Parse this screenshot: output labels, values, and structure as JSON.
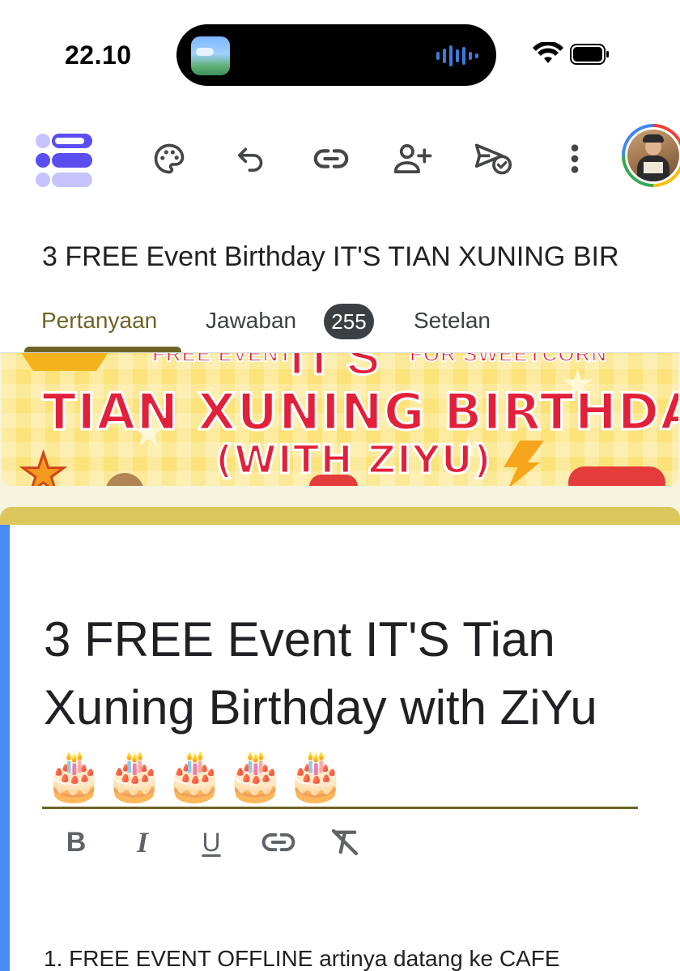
{
  "status_bar": {
    "time": "22.10"
  },
  "toolbar": {
    "icons": [
      "forms-logo",
      "palette-icon",
      "undo-icon",
      "link-icon",
      "add-collaborator-icon",
      "send-icon",
      "more-vert-icon",
      "avatar"
    ]
  },
  "form": {
    "doc_title": "3 FREE Event Birthday IT'S TIAN XUNING BIR"
  },
  "tabs": {
    "questions": "Pertanyaan",
    "responses": "Jawaban",
    "responses_count": "255",
    "settings": "Setelan",
    "active": "Pertanyaan"
  },
  "banner": {
    "top_left": "FREE EVENT",
    "top_its": "IT'S",
    "top_right": "FOR SWEETCORN",
    "main": "TIAN XUNING BIRTHDAY",
    "sub": "(WITH ZIYU)"
  },
  "card": {
    "title": "3 FREE Event  IT'S Tian Xuning Birthday with ZiYu 🎂🎂🎂🎂🎂",
    "format_bold": "B",
    "format_italic": "I",
    "format_underline": "U",
    "description": "1. FREE EVENT OFFLINE artinya datang ke CAFE"
  },
  "colors": {
    "accent": "#6f6326",
    "card_header": "#dbc75c",
    "card_side": "#4a8af4",
    "background": "#f6f3df",
    "banner_red": "#e2203a",
    "banner_yellow": "#fbe37a"
  }
}
